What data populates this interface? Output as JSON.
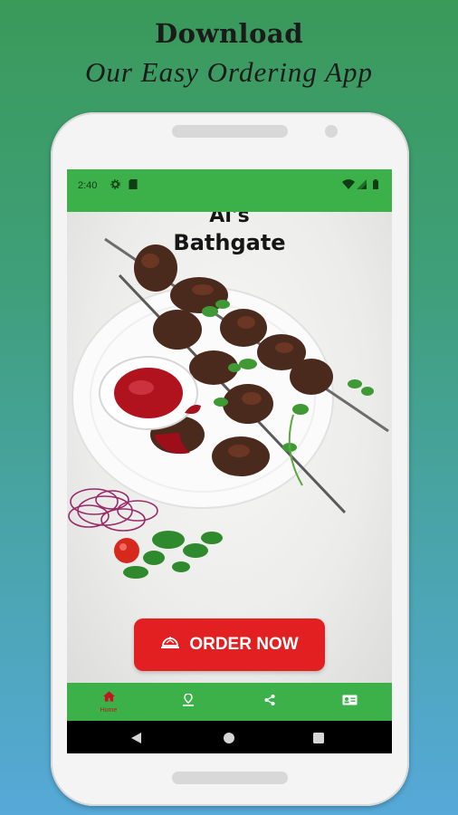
{
  "promo": {
    "line1": "Download",
    "line2": "Our Easy Ordering App"
  },
  "status_bar": {
    "time": "2:40"
  },
  "brand": {
    "line1": "Al's",
    "line2": "Bathgate"
  },
  "order_button": {
    "label": "ORDER NOW"
  },
  "bottom_nav": {
    "items": [
      {
        "label": "Home",
        "icon": "home-icon",
        "active": true
      },
      {
        "icon": "location-icon"
      },
      {
        "icon": "share-icon"
      },
      {
        "icon": "contact-card-icon"
      }
    ]
  },
  "colors": {
    "accent_green": "#3cb14a",
    "order_red": "#e32021",
    "active_nav": "#c0161c"
  }
}
